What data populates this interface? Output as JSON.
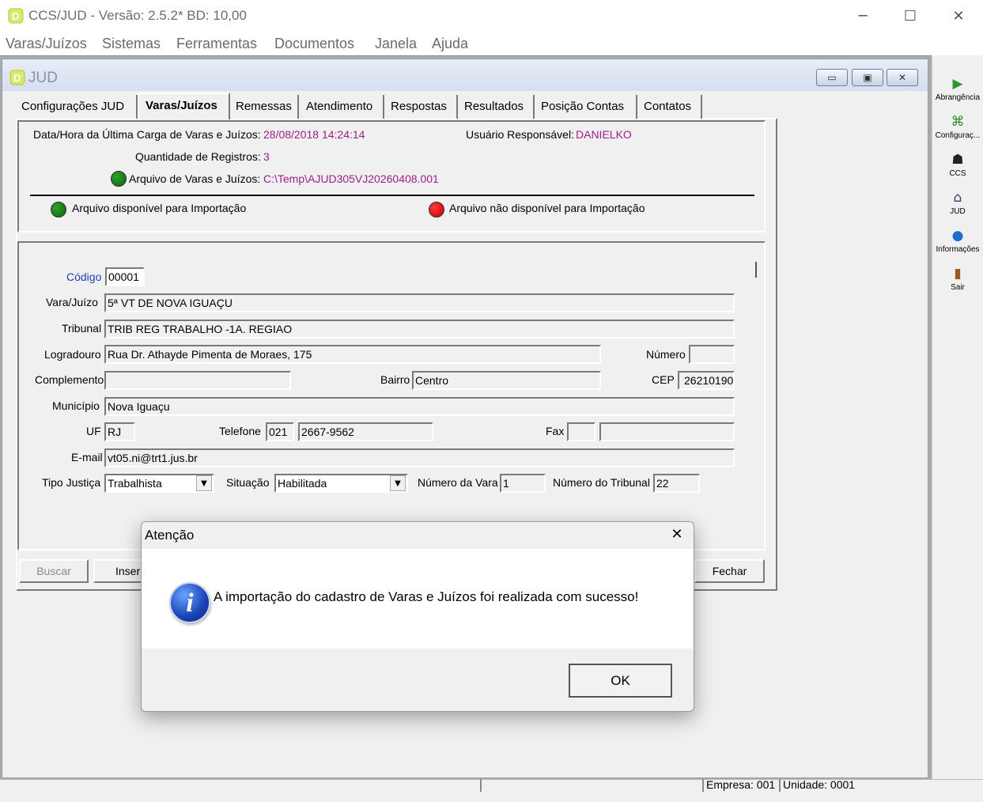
{
  "window": {
    "title": "CCS/JUD - Versão: 2.5.2* BD: 10,00",
    "minimize": "─",
    "maximize": "☐",
    "close": "✕"
  },
  "menu": [
    "Varas/Juízos",
    "Sistemas",
    "Ferramentas",
    "Documentos",
    "Janela",
    "Ajuda"
  ],
  "child_window": {
    "title": "JUD",
    "btn_min": "▭",
    "btn_restore": "▣",
    "btn_close": "✕"
  },
  "tabs": [
    "Configurações JUD",
    "Varas/Juízos",
    "Remessas",
    "Atendimento",
    "Respostas",
    "Resultados",
    "Posição Contas",
    "Contatos"
  ],
  "active_tab": "Varas/Juízos",
  "info": {
    "last_load_label": "Data/Hora da Última Carga de Varas e Juízos:",
    "last_load_value": "28/08/2018 14:24:14",
    "user_label": "Usuário Responsável:",
    "user_value": "DANIELKO",
    "records_label": "Quantidade de Registros:",
    "records_value": "3",
    "file_label": "Arquivo de Varas e Juízos:",
    "file_value": "C:\\Temp\\AJUD305VJ20260408.001",
    "legend_available": "Arquivo disponível para Importação",
    "legend_unavailable": "Arquivo não disponível para Importação"
  },
  "form": {
    "codigo_label": "Código",
    "codigo_value": "00001",
    "vara_label": "Vara/Juízo",
    "vara_value": "5ª VT DE NOVA IGUAÇU",
    "tribunal_label": "Tribunal",
    "tribunal_value": "TRIB REG TRABALHO -1A. REGIAO",
    "logradouro_label": "Logradouro",
    "logradouro_value": "Rua Dr. Athayde Pimenta de Moraes, 175",
    "numero_label": "Número",
    "numero_value": "",
    "complemento_label": "Complemento",
    "complemento_value": "",
    "bairro_label": "Bairro",
    "bairro_value": "Centro",
    "cep_label": "CEP",
    "cep_value": "26210190",
    "municipio_label": "Município",
    "municipio_value": "Nova Iguaçu",
    "uf_label": "UF",
    "uf_value": "RJ",
    "telefone_label": "Telefone",
    "telefone_ddd": "021",
    "telefone_value": "2667-9562",
    "fax_label": "Fax",
    "fax_ddd": "",
    "fax_value": "",
    "email_label": "E-mail",
    "email_value": "vt05.ni@trt1.jus.br",
    "tipo_label": "Tipo Justiça",
    "tipo_value": "Trabalhista",
    "situacao_label": "Situação",
    "situacao_value": "Habilitada",
    "num_vara_label": "Número da Vara",
    "num_vara_value": "1",
    "num_tribunal_label": "Número do Tribunal",
    "num_tribunal_value": "22"
  },
  "buttons": {
    "buscar": "Buscar",
    "inserir": "Inseri",
    "fechar": "Fechar"
  },
  "toolbar": [
    {
      "label": "Abrangência",
      "icon": "arrow-right-icon"
    },
    {
      "label": "Configuraç...",
      "icon": "settings-grid-icon"
    },
    {
      "label": "CCS",
      "icon": "ccs-icon"
    },
    {
      "label": "JUD",
      "icon": "courthouse-icon"
    },
    {
      "label": "Informações",
      "icon": "globe-icon"
    },
    {
      "label": "Sair",
      "icon": "exit-door-icon"
    }
  ],
  "status": {
    "empresa": "Empresa: 001",
    "unidade": "Unidade: 0001"
  },
  "dialog": {
    "title": "Atenção",
    "close": "✕",
    "icon": "i",
    "message": "A importação do cadastro de Varas e Juízos foi realizada com sucesso!",
    "ok": "OK"
  },
  "colors": {
    "value_text": "#9b1f8a",
    "link_label": "#1f3fbf",
    "available": "#0b7a0b",
    "unavailable": "#e00000"
  }
}
